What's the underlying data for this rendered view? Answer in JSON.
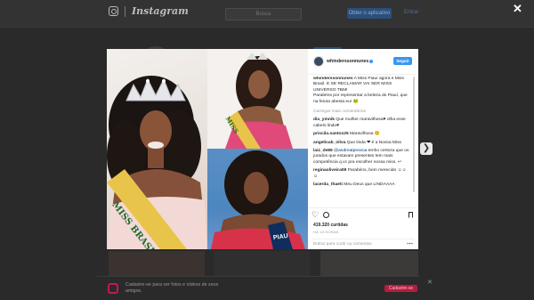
{
  "background": {
    "logo": "Instagram",
    "search_placeholder": "Busca",
    "obtain_button": "Obter o aplicativo",
    "login_link": "Entrar"
  },
  "modal": {
    "username": "whinderssonnunes",
    "follow_label": "Seguir",
    "caption_user": "whinderssonnunes",
    "caption_text": "A Miss Piauí agora é Miss Brasil. E SE RECLAMAR VAI SER MISS UNIVERSO TBM!",
    "caption_text2": "Parabéns por representar a beleza do Piauí, que na feiura abesta eu! 🐸",
    "load_more": "Carregar mais comentários",
    "comments": [
      {
        "user": "dia_ymnik",
        "text": "Que mulher maravilhosa♥ olha esse cabelo lindo♥"
      },
      {
        "user": "priscila.santos25",
        "text": "Maravilhosa 😊"
      },
      {
        "user": "angelicab_oliva",
        "text": "Que linda ❤ é a Nossa Miss"
      },
      {
        "user": "laiz_de89",
        "mention": "@andreatpessoa",
        "text": "tenho certeza que os jurados que estavam presentes tem mais competência q vc pra escolher nossa miss. ↩"
      },
      {
        "user": "reginaoliveira08",
        "text": "Parabéns, bem merecido ☺☺☺"
      },
      {
        "user": "lacerda_thaeti",
        "text": "Meu Deus que LINDAAAA"
      }
    ],
    "likes": "419.320 curtidas",
    "timestamp": "HÁ 15 HORAS",
    "add_comment_placeholder": "Entrar para curtir ou comentar.",
    "sash_text_left": "MISS BRASIL",
    "sash_text_rt": "MISS",
    "sash_text_rb": "PIAU"
  },
  "bottom_bar": {
    "text": "Cadastre-se para ver fotos e vídeos de seus amigos.",
    "button_label": "Cadastre-se"
  },
  "colors": {
    "accent": "#3897f0",
    "sash_gold": "#e8c54a",
    "dress_red": "#d8324a",
    "dress_pink": "#e04a7a"
  }
}
